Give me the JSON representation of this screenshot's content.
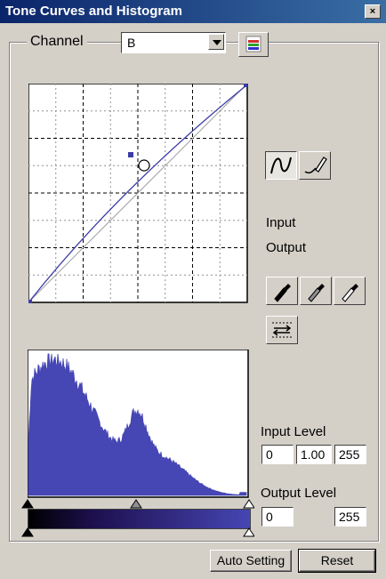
{
  "window": {
    "title": "Tone Curves and Histogram",
    "close_glyph": "×"
  },
  "channel": {
    "label": "Channel",
    "selected": "B",
    "options": [
      "B"
    ]
  },
  "icons": {
    "histogram_toggle": "histogram-icon",
    "curve_mode": "curve-icon",
    "freehand_mode": "pencil-icon",
    "black_point": "eyedropper-black-icon",
    "gray_point": "eyedropper-gray-icon",
    "white_point": "eyedropper-white-icon",
    "swap_levels": "swap-levels-icon"
  },
  "readouts": {
    "input_label": "Input",
    "output_label": "Output"
  },
  "input_level": {
    "label": "Input Level",
    "black": "0",
    "gamma": "1.00",
    "white": "255"
  },
  "output_level": {
    "label": "Output Level",
    "black": "0",
    "white": "255"
  },
  "buttons": {
    "auto_setting": "Auto Setting",
    "reset": "Reset"
  },
  "colors": {
    "curve": "#3c3ca8",
    "histogram": "#4646b4",
    "gradient_end": "#4646b4"
  }
}
